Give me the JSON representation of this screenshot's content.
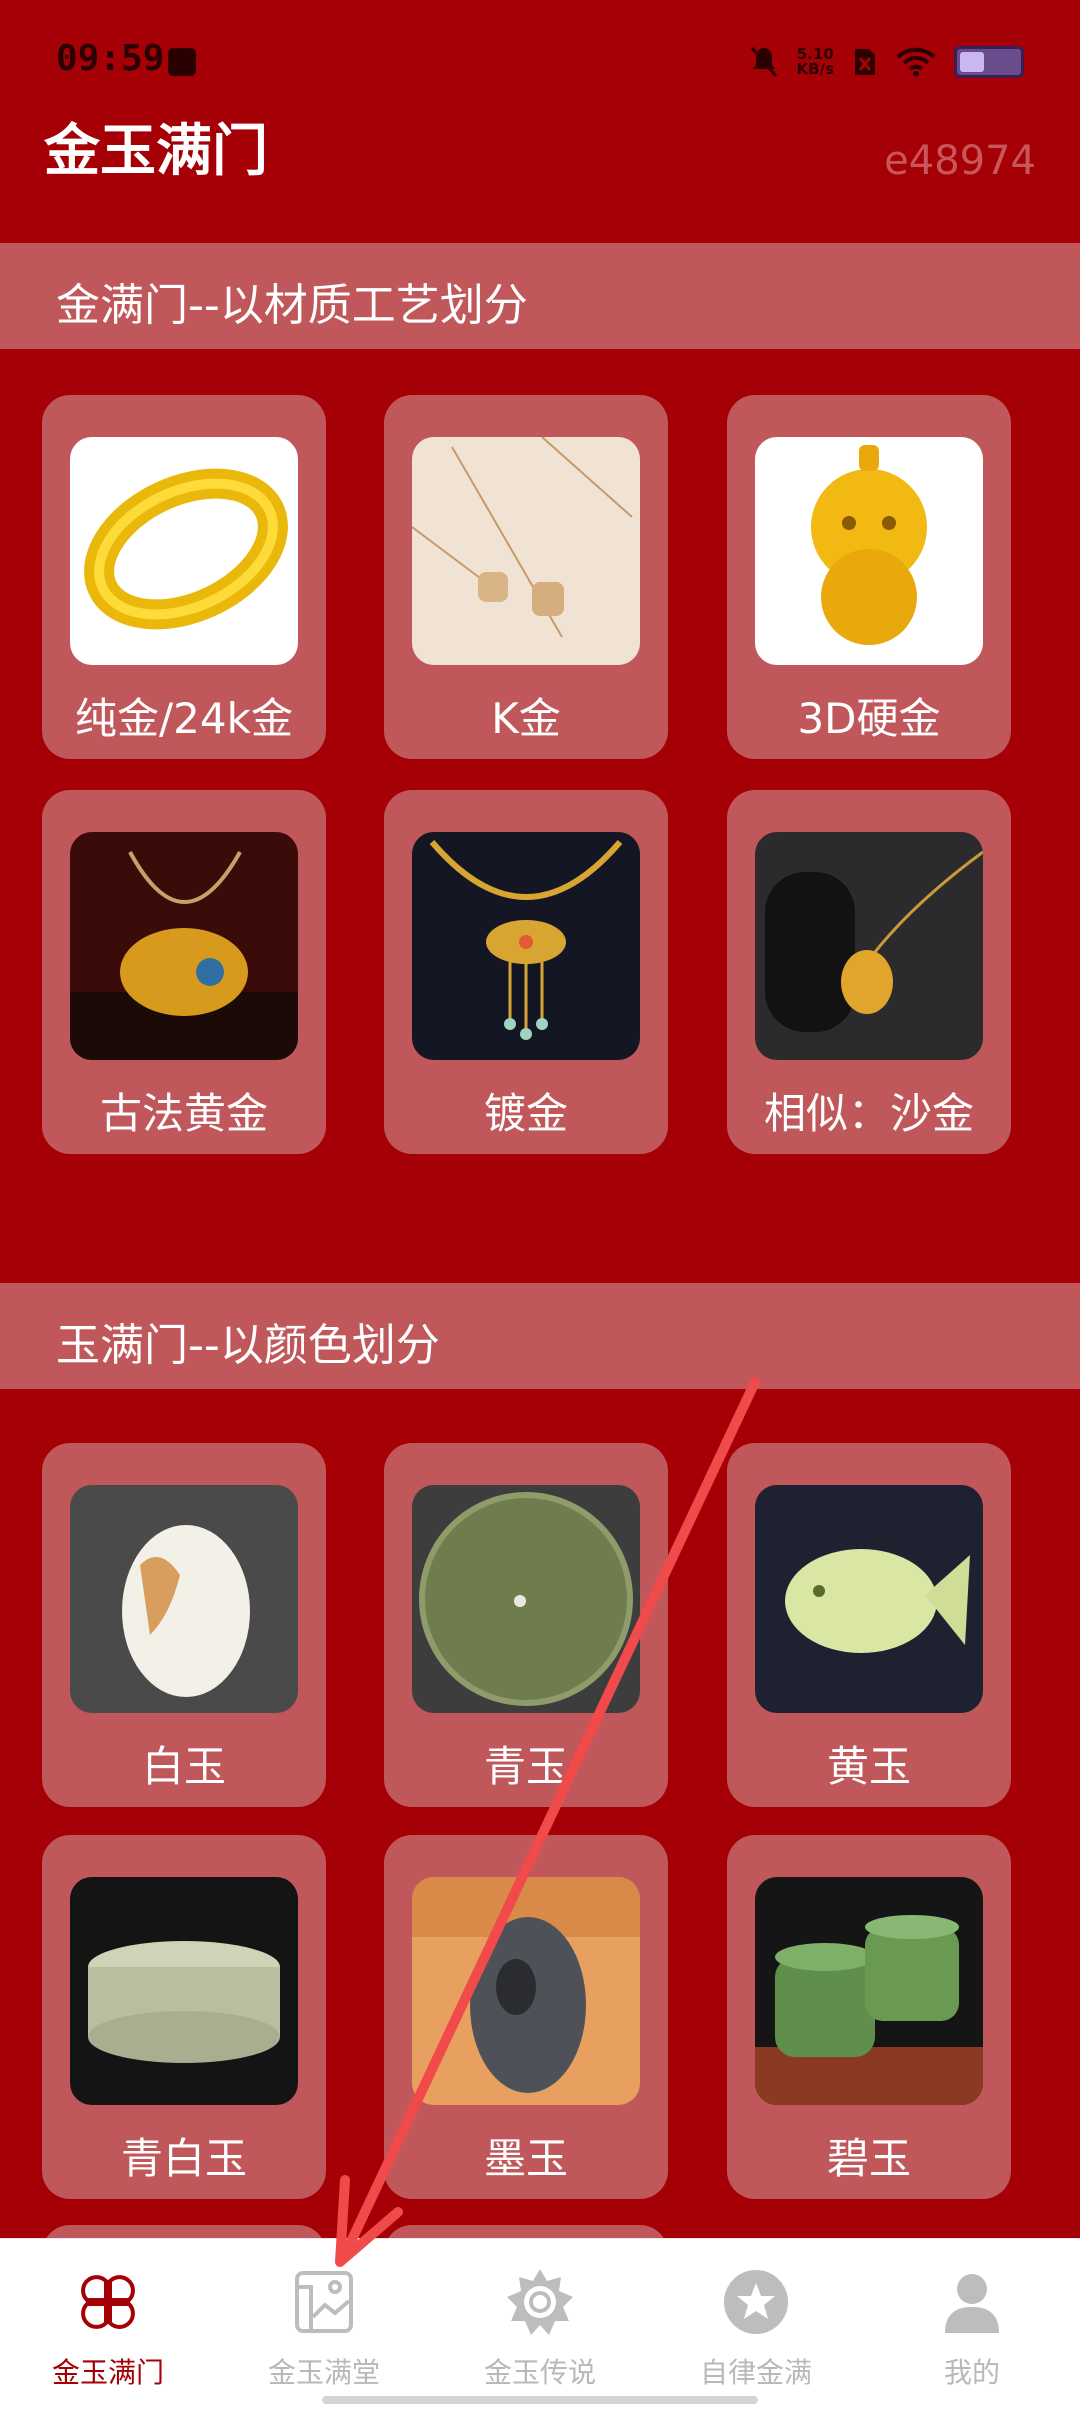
{
  "status_bar": {
    "time": "09:59",
    "speed_value": "5.10",
    "speed_unit": "KB/s"
  },
  "app": {
    "title": "金玉满门",
    "code": "e48974"
  },
  "gold_section": {
    "title": "金满门--以材质工艺划分",
    "items": [
      {
        "label": "纯金/24k金",
        "icon": "gold-ring"
      },
      {
        "label": "K金",
        "icon": "k-gold-necklace"
      },
      {
        "label": "3D硬金",
        "icon": "gold-tiger-pendant"
      },
      {
        "label": "古法黄金",
        "icon": "ancient-gold-pendant"
      },
      {
        "label": "镀金",
        "icon": "gold-plated-necklace"
      },
      {
        "label": "相似：沙金",
        "icon": "sand-gold-pendant"
      }
    ]
  },
  "jade_section": {
    "title": "玉满门--以颜色划分",
    "items": [
      {
        "label": "白玉",
        "icon": "white-jade"
      },
      {
        "label": "青玉",
        "icon": "green-jade-disc"
      },
      {
        "label": "黄玉",
        "icon": "yellow-jade-fish"
      },
      {
        "label": "青白玉",
        "icon": "celadon-jade-bowl"
      },
      {
        "label": "墨玉",
        "icon": "ink-jade-carving"
      },
      {
        "label": "碧玉",
        "icon": "jasper-cups"
      }
    ]
  },
  "bottom_nav": {
    "items": [
      {
        "label": "金玉满门",
        "icon": "clover-icon",
        "active": true
      },
      {
        "label": "金玉满堂",
        "icon": "scroll-map-icon",
        "active": false
      },
      {
        "label": "金玉传说",
        "icon": "compass-badge-icon",
        "active": false
      },
      {
        "label": "自律金满",
        "icon": "star-circle-icon",
        "active": false
      },
      {
        "label": "我的",
        "icon": "person-icon",
        "active": false
      }
    ]
  },
  "colors": {
    "background": "#a50005",
    "card": "#c0575a",
    "nav_active": "#a50005",
    "nav_inactive": "#b9b9b9",
    "annotation_arrow": "#f04a4a"
  }
}
